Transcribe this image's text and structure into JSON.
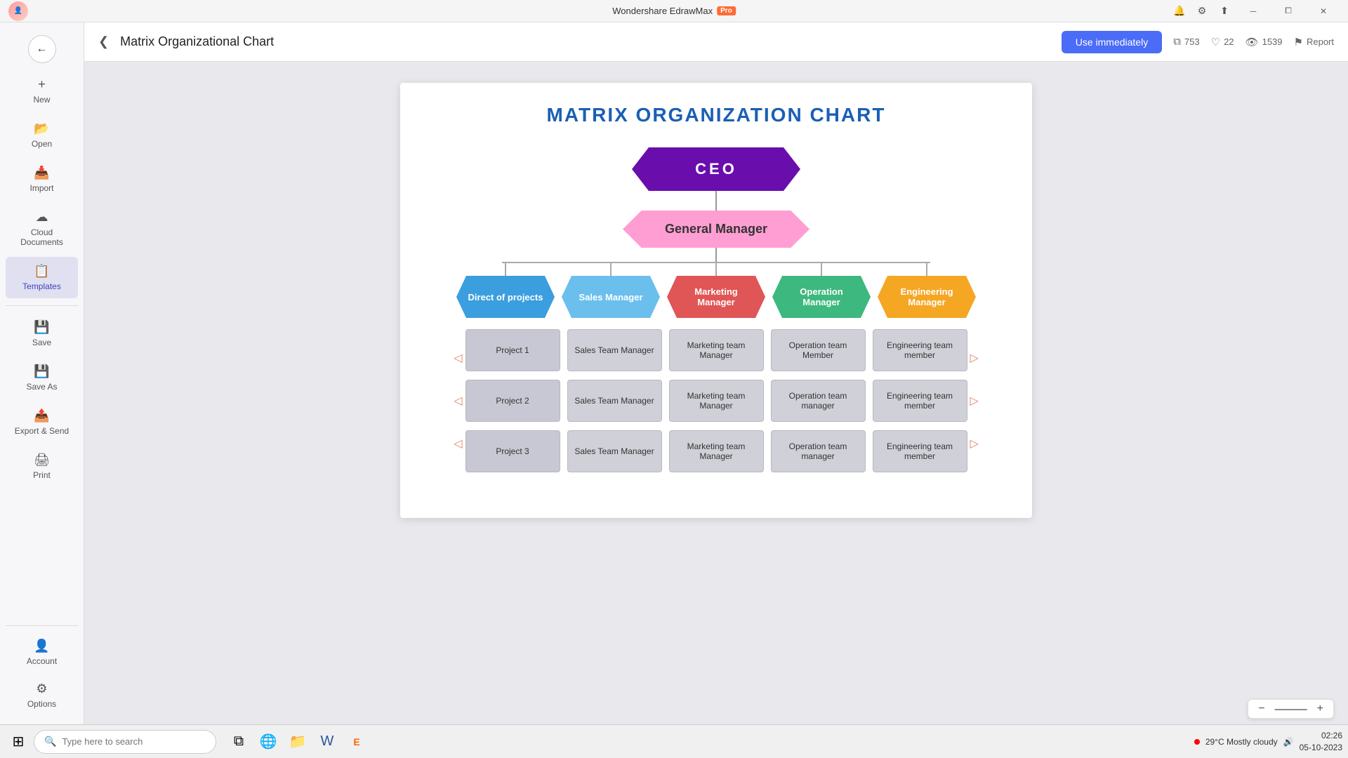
{
  "titleBar": {
    "appName": "Wondershare EdrawMax",
    "proBadge": "Pro",
    "minimizeLabel": "─",
    "restoreLabel": "⧠",
    "closeLabel": "✕"
  },
  "sidebar": {
    "backLabel": "←",
    "items": [
      {
        "id": "new",
        "icon": "＋",
        "label": "New"
      },
      {
        "id": "open",
        "icon": "📂",
        "label": "Open"
      },
      {
        "id": "import",
        "icon": "📥",
        "label": "Import"
      },
      {
        "id": "cloud",
        "icon": "☁",
        "label": "Cloud Documents"
      },
      {
        "id": "templates",
        "icon": "📋",
        "label": "Templates"
      },
      {
        "id": "save",
        "icon": "💾",
        "label": "Save"
      },
      {
        "id": "saveas",
        "icon": "💾",
        "label": "Save As"
      },
      {
        "id": "export",
        "icon": "📤",
        "label": "Export & Send"
      },
      {
        "id": "print",
        "icon": "🖨",
        "label": "Print"
      }
    ],
    "bottomItems": [
      {
        "id": "account",
        "icon": "👤",
        "label": "Account"
      },
      {
        "id": "options",
        "icon": "⚙",
        "label": "Options"
      }
    ]
  },
  "header": {
    "backArrow": "❮",
    "title": "Matrix Organizational Chart",
    "useButton": "Use immediately",
    "stats": {
      "copies": {
        "icon": "⧉",
        "value": "753"
      },
      "likes": {
        "icon": "♡",
        "value": "22"
      },
      "views": {
        "icon": "👁",
        "value": "1539"
      },
      "report": {
        "icon": "⚑",
        "label": "Report"
      }
    }
  },
  "diagram": {
    "title": "MATRIX ORGANIZATION CHART",
    "nodes": {
      "ceo": "CEO",
      "gm": "General Manager",
      "managers": [
        {
          "label": "Direct of projects",
          "color": "blue"
        },
        {
          "label": "Sales Manager",
          "color": "skyblue"
        },
        {
          "label": "Marketing Manager",
          "color": "red"
        },
        {
          "label": "Operation Manager",
          "color": "green"
        },
        {
          "label": "Engineering Manager",
          "color": "orange"
        }
      ],
      "rows": [
        [
          "Project 1",
          "Sales Team Manager",
          "Marketing team Manager",
          "Operation team Member",
          "Engineering team member"
        ],
        [
          "Project 2",
          "Sales Team Manager",
          "Marketing team Manager",
          "Operation team manager",
          "Engineering team member"
        ],
        [
          "Project 3",
          "Sales Team Manager",
          "Marketing team Manager",
          "Operation team manager",
          "Engineering team member"
        ]
      ]
    }
  },
  "zoom": {
    "minusLabel": "−",
    "valueLabel": "─",
    "plusLabel": "+"
  },
  "taskbar": {
    "searchPlaceholder": "Type here to search",
    "time": "02:26",
    "date": "05-10-2023",
    "weather": "29°C  Mostly cloudy"
  }
}
